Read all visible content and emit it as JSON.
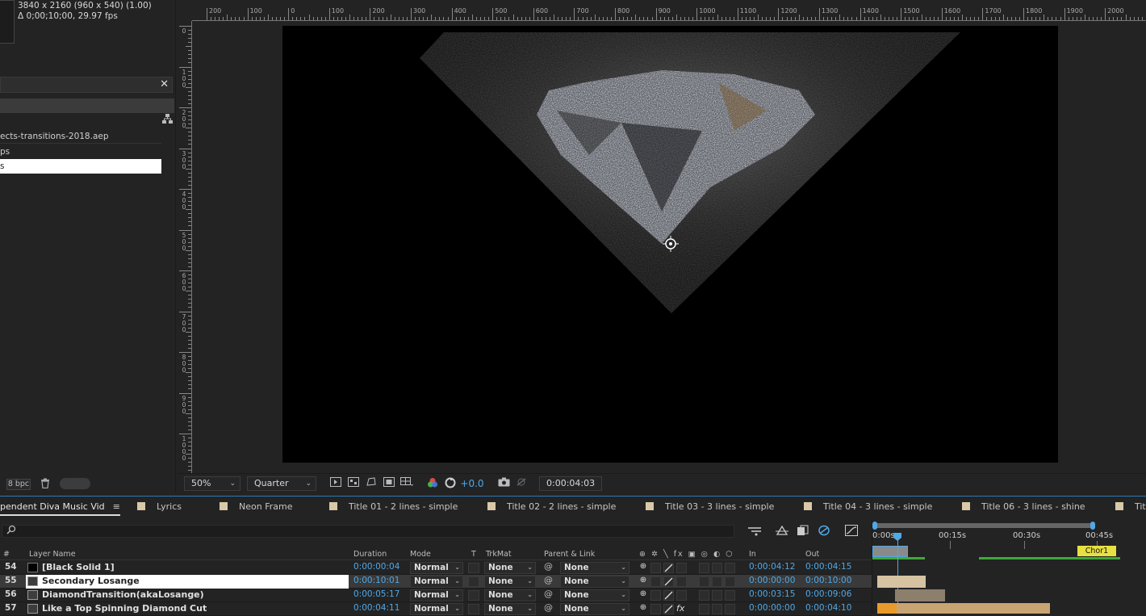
{
  "project": {
    "comp_size": "3840 x 2160  (960 x 540) (1.00)",
    "comp_duration": "Δ 0;00;10;00, 29.97 fps",
    "close_glyph": "✕",
    "items": [
      {
        "label": "ects-transitions-2018.aep"
      },
      {
        "label": "ps"
      },
      {
        "label": "s"
      }
    ],
    "bpc": "8 bpc"
  },
  "ruler": {
    "top_labels": [
      "200",
      "100",
      "0",
      "100",
      "200",
      "300",
      "400",
      "500",
      "600",
      "700",
      "800",
      "900",
      "1000",
      "1100",
      "1200",
      "1300",
      "1400",
      "1500",
      "1600",
      "1700",
      "1800",
      "1900",
      "2000"
    ],
    "left_labels": [
      "0",
      "100",
      "200",
      "300",
      "400",
      "500",
      "600",
      "700",
      "800",
      "900",
      "1000"
    ]
  },
  "viewer": {
    "zoom": "50%",
    "resolution": "Quarter",
    "exposure": "+0.0",
    "timecode": "0:00:04:03"
  },
  "tabs": [
    {
      "label": "pendent Diva Music Vid",
      "active": true,
      "menu": "≡"
    },
    {
      "label": "Lyrics"
    },
    {
      "label": "Neon Frame"
    },
    {
      "label": "Title 01 - 2 lines - simple"
    },
    {
      "label": "Title 02 - 2 lines - simple"
    },
    {
      "label": "Title 03 - 3 lines - simple"
    },
    {
      "label": "Title 04 - 3 lines - simple"
    },
    {
      "label": "Title 06 - 3 lines - shine"
    },
    {
      "label": "Title"
    }
  ],
  "columns": {
    "num": "#",
    "layer_name": "Layer Name",
    "duration": "Duration",
    "mode": "Mode",
    "t": "T",
    "trkmat": "TrkMat",
    "parent": "Parent & Link",
    "in": "In",
    "out": "Out"
  },
  "layers": [
    {
      "num": "54",
      "name": "[Black Solid 1]",
      "duration": "0:00:00:04",
      "mode": "Normal",
      "trkmat": "None",
      "parent": "None",
      "in": "0:00:04:12",
      "out": "0:00:04:15",
      "solid": true
    },
    {
      "num": "55",
      "name": "Secondary Losange",
      "duration": "0:00:10:01",
      "mode": "Normal",
      "trkmat": "None",
      "parent": "None",
      "in": "0:00:00:00",
      "out": "0:00:10:00",
      "selected": true
    },
    {
      "num": "56",
      "name": "DiamondTransition(akaLosange)",
      "duration": "0:00:05:17",
      "mode": "Normal",
      "trkmat": "None",
      "parent": "None",
      "in": "0:00:03:15",
      "out": "0:00:09:06"
    },
    {
      "num": "57",
      "name": "Like a Top Spinning Diamond Cut",
      "duration": "0:00:04:11",
      "mode": "Normal",
      "trkmat": "None",
      "parent": "None",
      "in": "0:00:00:00",
      "out": "0:00:04:10",
      "fx": "fx"
    }
  ],
  "graph": {
    "labels": [
      "0:00s",
      "00:15s",
      "00:30s",
      "00:45s"
    ],
    "marker": "Chor1"
  },
  "colors": {
    "accent_blue": "#4fa8e8",
    "tab_swatch": "#d9c9a8",
    "marker_yellow": "#e8e040",
    "work_green": "#3fa83a"
  }
}
